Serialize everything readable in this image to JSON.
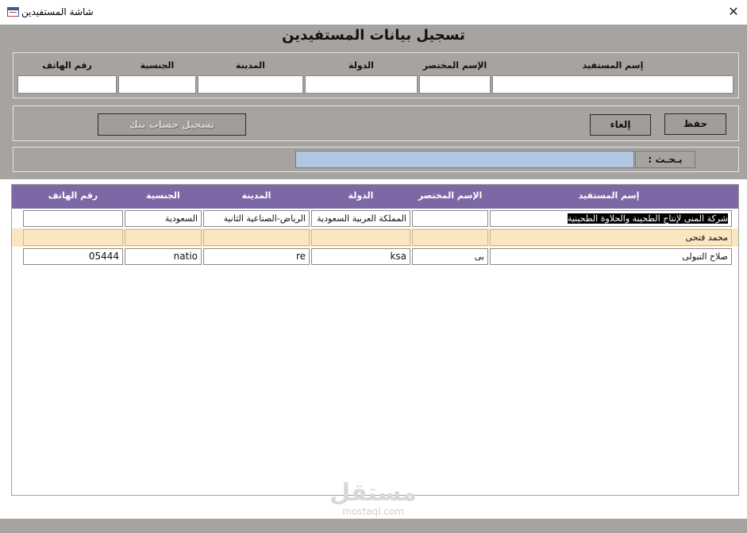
{
  "window": {
    "title": "شاشة المستفيدين"
  },
  "form": {
    "title": "تسجيل بيانات المستفيدين",
    "fields": [
      {
        "label": "إسم المستفيد",
        "value": ""
      },
      {
        "label": "الإسم المختصر",
        "value": ""
      },
      {
        "label": "الدولة",
        "value": ""
      },
      {
        "label": "المدينة",
        "value": ""
      },
      {
        "label": "الجنسية",
        "value": ""
      },
      {
        "label": "رقم الهاتف",
        "value": ""
      }
    ],
    "buttons": {
      "save": "حفظ",
      "cancel": "إلغاء",
      "register_bank": "تسجيل حساب بنك"
    },
    "search": {
      "label": "بـحـث :",
      "value": ""
    }
  },
  "grid": {
    "columns": [
      "إسم المستفيد",
      "الإسم المختصر",
      "الدولة",
      "المدينة",
      "الجنسية",
      "رقم الهاتف"
    ],
    "rows": [
      [
        "شركة المنى لإنتاج الطحينة والحلاوة الطحينية",
        "",
        "المملكة العربية السعودية",
        "الرياض-الصناعية الثانية",
        "السعودية",
        ""
      ],
      [
        "محمد فتحى",
        "",
        "",
        "",
        "",
        ""
      ],
      [
        "صلاح التبولى",
        "بى",
        "ksa",
        "re",
        "natio",
        "05444"
      ]
    ]
  },
  "watermark": {
    "logo": "مستقل",
    "domain": "mostaql.com"
  },
  "colors": {
    "form_background": "#a6a3a0",
    "grid_header": "#7e67a5",
    "alternate_row": "#fbe6c2",
    "search_input": "#b1c6e0"
  }
}
